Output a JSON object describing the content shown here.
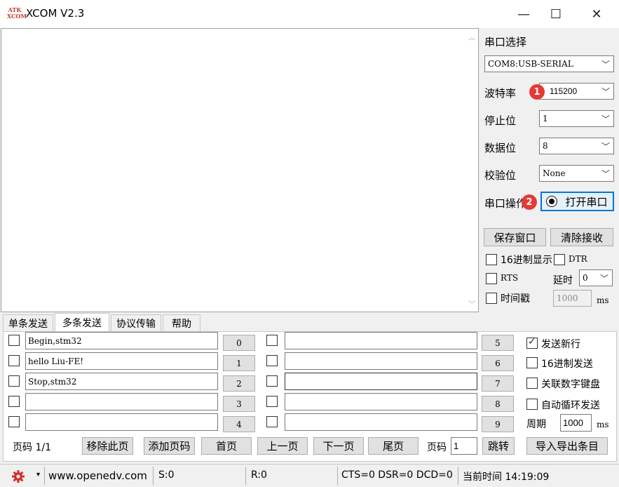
{
  "window": {
    "title": "XCOM V2.3",
    "logo_text": "ATK XCOM",
    "minimize": "—",
    "maximize": "☐",
    "close": "✕"
  },
  "serial": {
    "port_label": "串口选择",
    "port_value": "COM8:USB-SERIAL",
    "baud_label": "波特率",
    "baud_value": "115200",
    "stop_label": "停止位",
    "stop_value": "1",
    "data_label": "数据位",
    "data_value": "8",
    "parity_label": "校验位",
    "parity_value": "None",
    "op_label": "串口操作",
    "open_button": "打开串口",
    "save_window": "保存窗口",
    "clear_recv": "清除接收",
    "hex_display": "16进制显示",
    "dtr": "DTR",
    "rts": "RTS",
    "delay_label": "延时",
    "delay_value": "0",
    "timestamp": "时间戳",
    "timestamp_value": "1000",
    "ms": "ms"
  },
  "badges": {
    "one": "1",
    "two": "2"
  },
  "tabs": [
    {
      "label": "单条发送"
    },
    {
      "label": "多条发送"
    },
    {
      "label": "协议传输"
    },
    {
      "label": "帮助"
    }
  ],
  "multi": {
    "left_rows": [
      {
        "text": "Begin,stm32",
        "btn": "0"
      },
      {
        "text": "hello Liu-FE!",
        "btn": "1"
      },
      {
        "text": "Stop,stm32",
        "btn": "2"
      },
      {
        "text": "",
        "btn": "3"
      },
      {
        "text": "",
        "btn": "4"
      }
    ],
    "right_rows": [
      {
        "text": "",
        "btn": "5"
      },
      {
        "text": "",
        "btn": "6"
      },
      {
        "text": "",
        "btn": "7"
      },
      {
        "text": "",
        "btn": "8"
      },
      {
        "text": "",
        "btn": "9"
      }
    ],
    "send_newline": "发送新行",
    "hex_send": "16进制发送",
    "link_keyboard": "关联数字键盘",
    "auto_loop": "自动循环发送",
    "period_label": "周期",
    "period_value": "1000",
    "ms": "ms"
  },
  "pager": {
    "page_info": "页码 1/1",
    "remove_page": "移除此页",
    "add_page": "添加页码",
    "first": "首页",
    "prev": "上一页",
    "next": "下一页",
    "last": "尾页",
    "page_label": "页码",
    "page_value": "1",
    "jump": "跳转",
    "import_export": "导入导出条目"
  },
  "status": {
    "website": "www.openedv.com",
    "sent": "S:0",
    "received": "R:0",
    "lines": "CTS=0 DSR=0 DCD=0",
    "time": "当前时间 14:19:09"
  },
  "colors": {
    "badge": "#e53935",
    "gear": "#d32f2f",
    "logo": "#c0392b"
  }
}
